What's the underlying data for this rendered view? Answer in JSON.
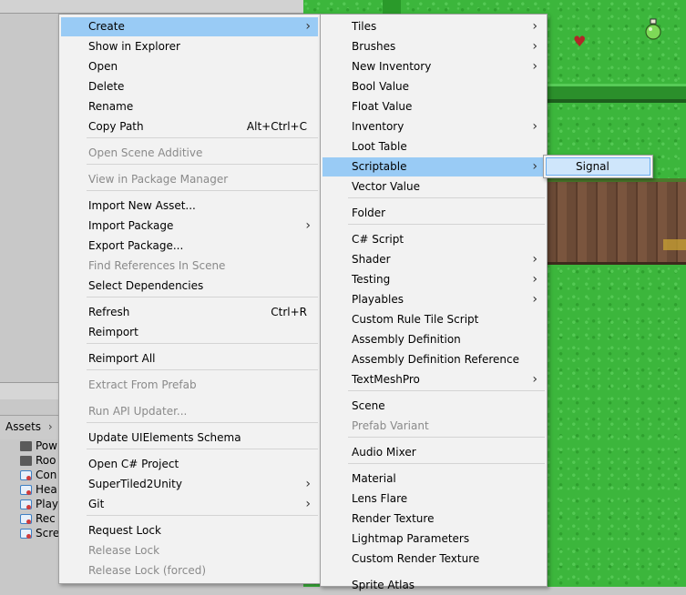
{
  "project_panel": {
    "tab_label": "Assets",
    "tab_arrow": "›",
    "assets": [
      {
        "label": "Pow",
        "icon": "folder-icon"
      },
      {
        "label": "Roo",
        "icon": "folder-icon"
      },
      {
        "label": "Con",
        "icon": "script-asset-icon"
      },
      {
        "label": "Hea",
        "icon": "script-asset-icon"
      },
      {
        "label": "Play",
        "icon": "script-asset-icon"
      },
      {
        "label": "Rec",
        "icon": "script-asset-icon"
      },
      {
        "label": "Scre",
        "icon": "script-asset-icon"
      }
    ]
  },
  "context_menu": {
    "items": [
      {
        "label": "Create",
        "submenu": true,
        "highlight": true
      },
      {
        "label": "Show in Explorer"
      },
      {
        "label": "Open"
      },
      {
        "label": "Delete"
      },
      {
        "label": "Rename"
      },
      {
        "label": "Copy Path",
        "shortcut": "Alt+Ctrl+C"
      },
      {
        "label": "Open Scene Additive",
        "disabled": true
      },
      {
        "label": "View in Package Manager",
        "disabled": true
      },
      {
        "label": "Import New Asset..."
      },
      {
        "label": "Import Package",
        "submenu": true
      },
      {
        "label": "Export Package..."
      },
      {
        "label": "Find References In Scene",
        "disabled": true
      },
      {
        "label": "Select Dependencies"
      },
      {
        "label": "Refresh",
        "shortcut": "Ctrl+R"
      },
      {
        "label": "Reimport"
      },
      {
        "label": "Reimport All"
      },
      {
        "label": "Extract From Prefab",
        "disabled": true
      },
      {
        "label": "Run API Updater...",
        "disabled": true
      },
      {
        "label": "Update UIElements Schema"
      },
      {
        "label": "Open C# Project"
      },
      {
        "label": "SuperTiled2Unity",
        "submenu": true
      },
      {
        "label": "Git",
        "submenu": true
      },
      {
        "label": "Request Lock"
      },
      {
        "label": "Release Lock",
        "disabled": true
      },
      {
        "label": "Release Lock (forced)",
        "disabled": true
      }
    ]
  },
  "create_submenu": {
    "items": [
      {
        "label": "Tiles",
        "submenu": true
      },
      {
        "label": "Brushes",
        "submenu": true
      },
      {
        "label": "New Inventory",
        "submenu": true
      },
      {
        "label": "Bool Value"
      },
      {
        "label": "Float Value"
      },
      {
        "label": "Inventory",
        "submenu": true
      },
      {
        "label": "Loot Table"
      },
      {
        "label": "Scriptable",
        "submenu": true,
        "highlight": true
      },
      {
        "label": "Vector Value"
      },
      {
        "label": "Folder"
      },
      {
        "label": "C# Script"
      },
      {
        "label": "Shader",
        "submenu": true
      },
      {
        "label": "Testing",
        "submenu": true
      },
      {
        "label": "Playables",
        "submenu": true
      },
      {
        "label": "Custom Rule Tile Script"
      },
      {
        "label": "Assembly Definition"
      },
      {
        "label": "Assembly Definition Reference"
      },
      {
        "label": "TextMeshPro",
        "submenu": true
      },
      {
        "label": "Scene"
      },
      {
        "label": "Prefab Variant",
        "disabled": true
      },
      {
        "label": "Audio Mixer"
      },
      {
        "label": "Material"
      },
      {
        "label": "Lens Flare"
      },
      {
        "label": "Render Texture"
      },
      {
        "label": "Lightmap Parameters"
      },
      {
        "label": "Custom Render Texture"
      },
      {
        "label": "Sprite Atlas"
      }
    ]
  },
  "scriptable_submenu": {
    "items": [
      {
        "label": "Signal"
      }
    ]
  },
  "colors": {
    "menu_bg": "#f2f2f2",
    "highlight": "#99cbf5",
    "disabled_text": "#8a8a8a",
    "grass": "#3cb63c"
  },
  "arrow_glyph": "›"
}
